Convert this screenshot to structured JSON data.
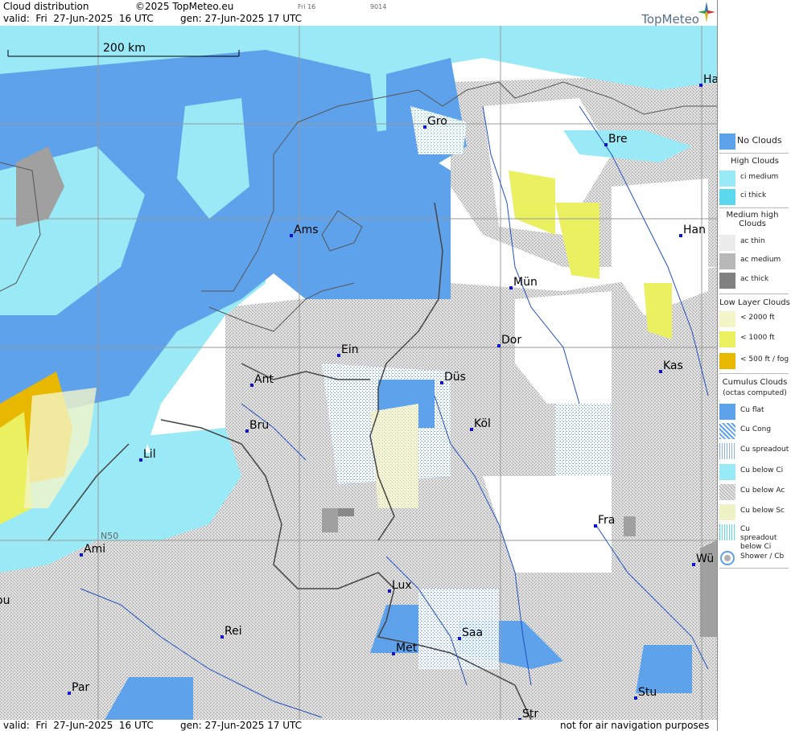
{
  "header": {
    "title": "Cloud distribution",
    "copyright": "©2025 TopMeteo.eu",
    "valid": "valid:  Fri  27-Jun-2025  16 UTC",
    "generated": "gen: 27-Jun-2025 17 UTC",
    "small_day": "Fri 16",
    "small_code": "9014",
    "brand": "TopMeteo"
  },
  "map": {
    "scale_label": "200 km",
    "latitude_label": "N50",
    "cities": [
      {
        "name": "Gro",
        "label": "Gro"
      },
      {
        "name": "Bre",
        "label": "Bre"
      },
      {
        "name": "Ha",
        "label": "Ha"
      },
      {
        "name": "Ams",
        "label": "Ams"
      },
      {
        "name": "Han",
        "label": "Han"
      },
      {
        "name": "Mün",
        "label": "Mün"
      },
      {
        "name": "Ein",
        "label": "Ein"
      },
      {
        "name": "Dor",
        "label": "Dor"
      },
      {
        "name": "Ant",
        "label": "Ant"
      },
      {
        "name": "Düs",
        "label": "Düs"
      },
      {
        "name": "Kas",
        "label": "Kas"
      },
      {
        "name": "Bru",
        "label": "Bru"
      },
      {
        "name": "Köl",
        "label": "Köl"
      },
      {
        "name": "Lil",
        "label": "Lil"
      },
      {
        "name": "Fra",
        "label": "Fra"
      },
      {
        "name": "Ami",
        "label": "Ami"
      },
      {
        "name": "Wü",
        "label": "Wü"
      },
      {
        "name": "Lux",
        "label": "Lux"
      },
      {
        "name": "ou",
        "label": "ou"
      },
      {
        "name": "Rei",
        "label": "Rei"
      },
      {
        "name": "Saa",
        "label": "Saa"
      },
      {
        "name": "Met",
        "label": "Met"
      },
      {
        "name": "Par",
        "label": "Par"
      },
      {
        "name": "Stu",
        "label": "Stu"
      },
      {
        "name": "Str",
        "label": "Str"
      }
    ]
  },
  "footer": {
    "valid": "valid:  Fri  27-Jun-2025  16 UTC",
    "generated": "gen: 27-Jun-2025 17 UTC",
    "disclaimer": "not for air navigation purposes"
  },
  "legend": {
    "no_clouds": {
      "label": "No Clouds",
      "color": "#5fa2ec"
    },
    "high_title": "High Clouds",
    "high": [
      {
        "label": "ci medium",
        "color": "#9ae9f6"
      },
      {
        "label": "ci thick",
        "color": "#5cd8ee"
      }
    ],
    "medium_title": "Medium high Clouds",
    "medium": [
      {
        "label": "ac thin",
        "color": "#ececec"
      },
      {
        "label": "ac medium",
        "color": "#b8b8b8"
      },
      {
        "label": "ac thick",
        "color": "#808080"
      }
    ],
    "low_title": "Low Layer Clouds",
    "low": [
      {
        "label": "< 2000 ft",
        "color": "#f3f5c8"
      },
      {
        "label": "< 1000 ft",
        "color": "#eaf060"
      },
      {
        "label": "< 500 ft / fog",
        "color": "#e8b800"
      }
    ],
    "cumulus_title": "Cumulus Clouds",
    "cumulus_subtitle": "(octas computed)",
    "cumulus": [
      {
        "label": "Cu flat",
        "color": "#5fa2ec"
      },
      {
        "label": "Cu Cong",
        "color": "#8fb7e8"
      },
      {
        "label": "Cu spreadout",
        "color": "#88b0e0"
      },
      {
        "label": "Cu below Ci",
        "color": "#9ae9f6"
      },
      {
        "label": "Cu below Ac",
        "color": "#c8c8c8"
      },
      {
        "label": "Cu below Sc",
        "color": "#eef2c4"
      },
      {
        "label": "Cu spreadout below Ci",
        "color": "#b8e6ee"
      },
      {
        "label": "Shower / Cb",
        "color": "#ffffff"
      }
    ]
  }
}
